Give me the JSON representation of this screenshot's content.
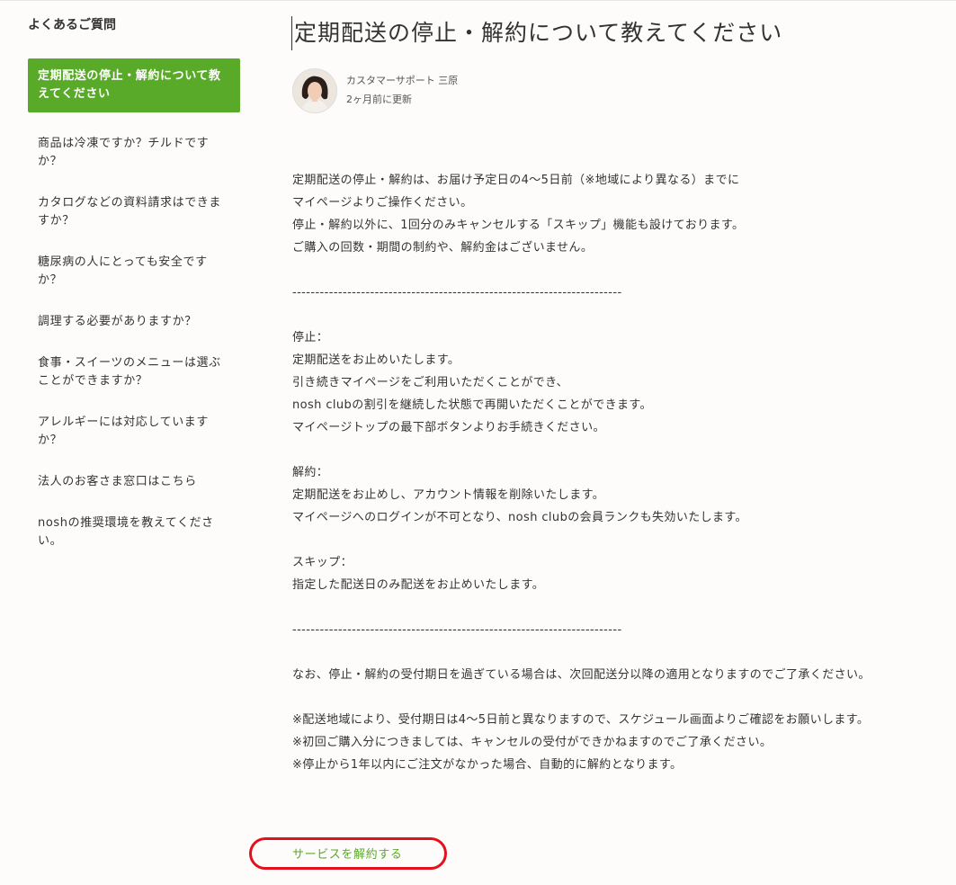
{
  "sidebar": {
    "title": "よくあるご質問",
    "items": [
      {
        "label": "定期配送の停止・解約について教えてください",
        "active": true
      },
      {
        "label": "商品は冷凍ですか？チルドですか？"
      },
      {
        "label": "カタログなどの資料請求はできますか？"
      },
      {
        "label": "糖尿病の人にとっても安全ですか？"
      },
      {
        "label": "調理する必要がありますか？"
      },
      {
        "label": "食事・スイーツのメニューは選ぶことができますか？"
      },
      {
        "label": "アレルギーには対応していますか？"
      },
      {
        "label": "法人のお客さま窓口はこちら"
      },
      {
        "label": "noshの推奨環境を教えてください。"
      }
    ]
  },
  "article": {
    "title": "定期配送の停止・解約について教えてください",
    "author": "カスタマーサポート 三原",
    "updated": "2ヶ月前に更新",
    "lines": [
      "定期配送の停止・解約は、お届け予定日の4〜5日前（※地域により異なる）までに",
      "マイページよりご操作ください。",
      "停止・解約以外に、1回分のみキャンセルする「スキップ」機能も設けております。",
      "ご購入の回数・期間の制約や、解約金はございません。",
      "",
      "------------------------------------------------------------------------",
      "",
      "停止：",
      "定期配送をお止めいたします。",
      "引き続きマイページをご利用いただくことができ、",
      "nosh clubの割引を継続した状態で再開いただくことができます。",
      "マイページトップの最下部ボタンよりお手続きください。",
      "",
      "解約：",
      "定期配送をお止めし、アカウント情報を削除いたします。",
      "マイページへのログインが不可となり、nosh clubの会員ランクも失効いたします。",
      "",
      "スキップ：",
      "指定した配送日のみ配送をお止めいたします。",
      "",
      "------------------------------------------------------------------------",
      "",
      "なお、停止・解約の受付期日を過ぎている場合は、次回配送分以降の適用となりますのでご了承ください。",
      "",
      "※配送地域により、受付期日は4〜5日前と異なりますので、スケジュール画面よりご確認をお願いします。",
      "※初回ご購入分につきましては、キャンセルの受付ができかねますのでご了承ください。",
      "※停止から1年以内にご注文がなかった場合、自動的に解約となります。"
    ],
    "cta_label": "サービスを解約する"
  },
  "colors": {
    "accent": "#5aaa29",
    "highlight_ring": "#e4101b"
  }
}
